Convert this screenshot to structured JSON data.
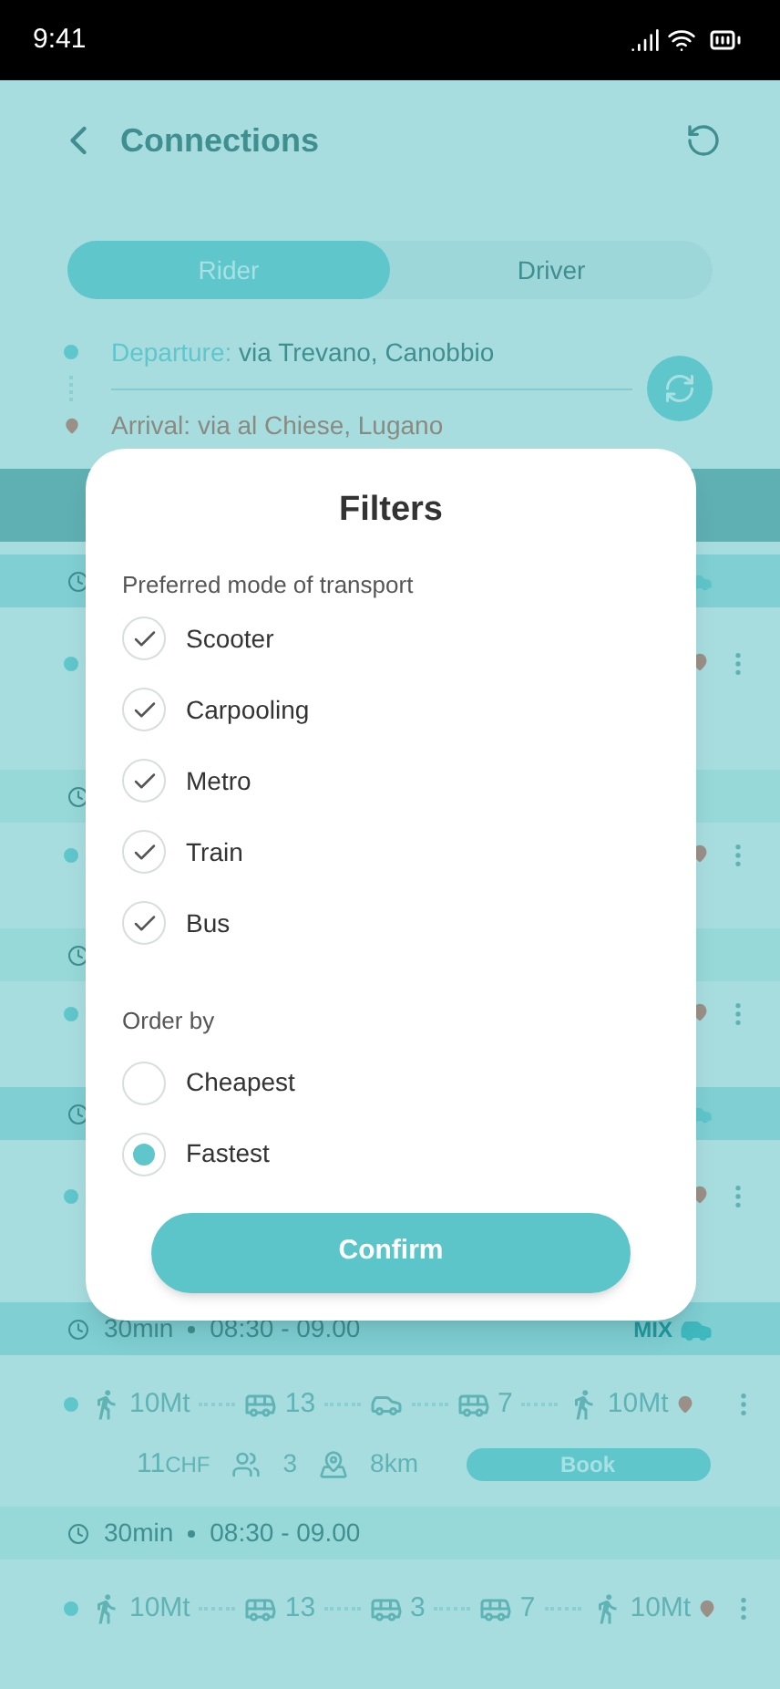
{
  "status_bar": {
    "time": "9:41"
  },
  "header": {
    "title": "Connections"
  },
  "tabs": [
    {
      "label": "Rider",
      "selected": true
    },
    {
      "label": "Driver",
      "selected": false
    }
  ],
  "route": {
    "departure_label": "Departure:",
    "departure": "via Trevano, Canobbio",
    "arrival_label": "Arrival:",
    "arrival": "via al Chiese, Lugano"
  },
  "band": {
    "shown": true
  },
  "covered_connections": [
    {
      "vehicle": true,
      "details": true
    },
    {
      "vehicle": false,
      "details": false
    },
    {
      "vehicle": false,
      "details": false
    },
    {
      "vehicle": true,
      "details": true
    }
  ],
  "connections": [
    {
      "vehicle": true,
      "duration": "30min",
      "times": "08:30 - 09.00",
      "tag": "MIX",
      "legs": [
        {
          "kind": "walk",
          "label": "10Mt"
        },
        {
          "kind": "bus",
          "label": "13"
        },
        {
          "kind": "car"
        },
        {
          "kind": "bus",
          "label": "7"
        },
        {
          "kind": "walk",
          "label": "10Mt"
        }
      ],
      "price": "11",
      "currency": "CHF",
      "seats": "3",
      "distance": "8km",
      "action": "Book"
    },
    {
      "vehicle": false,
      "duration": "30min",
      "times": "08:30 - 09.00",
      "legs": [
        {
          "kind": "walk",
          "label": "10Mt"
        },
        {
          "kind": "bus",
          "label": "13"
        },
        {
          "kind": "bus",
          "label": "3"
        },
        {
          "kind": "bus",
          "label": "7"
        },
        {
          "kind": "walk",
          "label": "10Mt"
        }
      ]
    }
  ],
  "filters": {
    "title": "Filters",
    "modes_heading": "Preferred mode of transport",
    "modes": [
      {
        "label": "Scooter",
        "checked": true
      },
      {
        "label": "Carpooling",
        "checked": true
      },
      {
        "label": "Metro",
        "checked": true
      },
      {
        "label": "Train",
        "checked": true
      },
      {
        "label": "Bus",
        "checked": true
      }
    ],
    "order_heading": "Order by",
    "order": [
      {
        "label": "Cheapest",
        "selected": false
      },
      {
        "label": "Fastest",
        "selected": true
      }
    ],
    "confirm": "Confirm"
  }
}
